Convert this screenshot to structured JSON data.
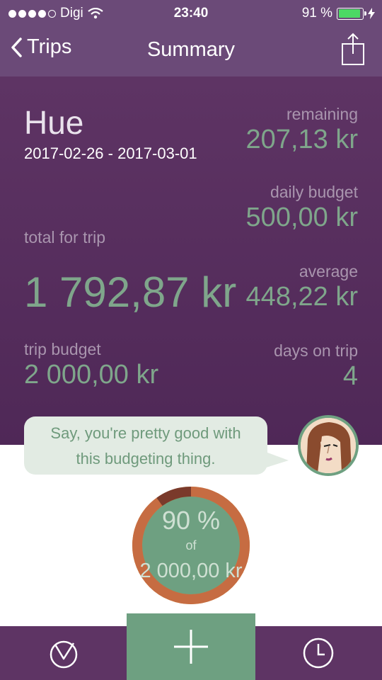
{
  "status_bar": {
    "carrier": "Digi",
    "time": "23:40",
    "battery": "91 %",
    "battery_level": 0.91,
    "signal_bars": 4
  },
  "nav": {
    "back_label": "Trips",
    "title": "Summary"
  },
  "summary": {
    "trip_name": "Hue",
    "trip_dates": "2017-02-26 - 2017-03-01",
    "total_label": "total for trip",
    "total_value": "1 792,87 kr",
    "trip_budget_label": "trip budget",
    "trip_budget_value": "2 000,00 kr",
    "remaining_label": "remaining",
    "remaining_value": "207,13 kr",
    "daily_budget_label": "daily budget",
    "daily_budget_value": "500,00 kr",
    "average_label": "average",
    "average_value": "448,22 kr",
    "days_label": "days on trip",
    "days_value": "4"
  },
  "message": {
    "line1": "Say, you're pretty good with",
    "line2": "this budgeting thing."
  },
  "progress": {
    "percent_text": "90 %",
    "of_text": "of",
    "budget_text": "2 000,00 kr",
    "fraction": 0.9
  },
  "tabs": {
    "left_icon": "pie-chart-icon",
    "center_icon": "plus-icon",
    "right_icon": "clock-icon"
  },
  "colors": {
    "purple": "#5e3464",
    "green": "#6ea081",
    "value_green": "#7fa68b"
  }
}
